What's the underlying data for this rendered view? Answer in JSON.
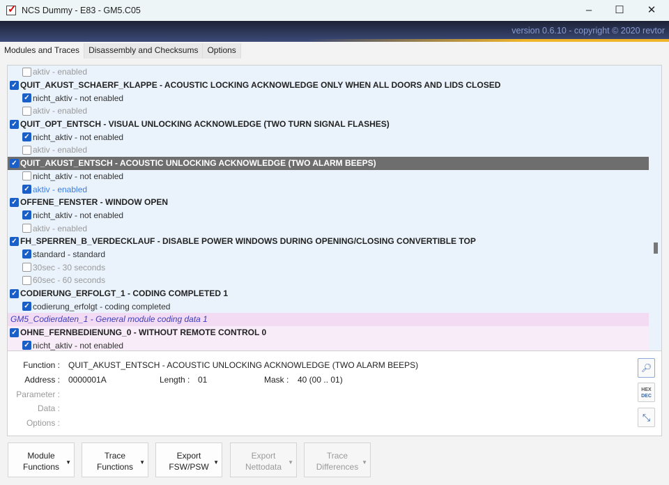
{
  "window": {
    "title": "NCS Dummy - E83 - GM5.C05",
    "minimize": "–",
    "maximize": "☐",
    "close": "✕"
  },
  "banner": {
    "version": "version 0.6.10 - copyright © 2020 revtor"
  },
  "tabs": [
    "Modules and Traces",
    "Disassembly and Checksums",
    "Options"
  ],
  "rows": [
    {
      "type": "opt",
      "state": "off",
      "checked": false,
      "text": "aktiv  -  enabled"
    },
    {
      "type": "head",
      "checked": true,
      "text": "QUIT_AKUST_SCHAERF_KLAPPE  -  ACOUSTIC LOCKING ACKNOWLEDGE ONLY WHEN ALL DOORS AND LIDS CLOSED"
    },
    {
      "type": "opt",
      "state": "on",
      "checked": true,
      "text": "nicht_aktiv  -  not enabled"
    },
    {
      "type": "opt",
      "state": "off",
      "checked": false,
      "text": "aktiv  -  enabled"
    },
    {
      "type": "head",
      "checked": true,
      "text": "QUIT_OPT_ENTSCH  -  VISUAL UNLOCKING ACKNOWLEDGE (TWO TURN SIGNAL FLASHES)"
    },
    {
      "type": "opt",
      "state": "on",
      "checked": true,
      "text": "nicht_aktiv  -  not enabled"
    },
    {
      "type": "opt",
      "state": "off",
      "checked": false,
      "text": "aktiv  -  enabled"
    },
    {
      "type": "head",
      "selected": true,
      "checked": true,
      "text": "QUIT_AKUST_ENTSCH  -  ACOUSTIC UNLOCKING ACKNOWLEDGE (TWO ALARM BEEPS)"
    },
    {
      "type": "opt",
      "state": "on",
      "checked": false,
      "text": "nicht_aktiv  -  not enabled"
    },
    {
      "type": "opt",
      "state": "blue",
      "checked": true,
      "text": "aktiv  -  enabled"
    },
    {
      "type": "head",
      "checked": true,
      "text": "OFFENE_FENSTER  -  WINDOW OPEN"
    },
    {
      "type": "opt",
      "state": "on",
      "checked": true,
      "text": "nicht_aktiv  -  not enabled"
    },
    {
      "type": "opt",
      "state": "off",
      "checked": false,
      "text": "aktiv  -  enabled"
    },
    {
      "type": "head",
      "checked": true,
      "text": "FH_SPERREN_B_VERDECKLAUF  -  DISABLE POWER WINDOWS DURING OPENING/CLOSING CONVERTIBLE TOP"
    },
    {
      "type": "opt",
      "state": "on",
      "checked": true,
      "text": "standard  -  standard"
    },
    {
      "type": "opt",
      "state": "off",
      "checked": false,
      "text": "30sec  -  30 seconds"
    },
    {
      "type": "opt",
      "state": "off",
      "checked": false,
      "text": "60sec  -  60 seconds"
    },
    {
      "type": "head",
      "checked": true,
      "text": "CODIERUNG_ERFOLGT_1  -  CODING COMPLETED 1"
    },
    {
      "type": "opt",
      "state": "on",
      "checked": true,
      "text": "codierung_erfolgt  -  coding completed"
    },
    {
      "type": "group",
      "text": "GM5_Codierdaten_1  -  General module coding data 1"
    },
    {
      "type": "head",
      "pink": true,
      "checked": true,
      "text": "OHNE_FERNBEDIENUNG_0  -  WITHOUT REMOTE CONTROL 0"
    },
    {
      "type": "opt",
      "pink": true,
      "state": "on",
      "checked": true,
      "text": "nicht_aktiv  -  not enabled"
    }
  ],
  "details": {
    "function_label": "Function :",
    "function_value": "QUIT_AKUST_ENTSCH  -  ACOUSTIC UNLOCKING ACKNOWLEDGE (TWO ALARM BEEPS)",
    "address_label": "Address :",
    "address_value": "0000001A",
    "length_label": "Length :",
    "length_value": "01",
    "mask_label": "Mask :",
    "mask_value": "40  (00 .. 01)",
    "parameter_label": "Parameter :",
    "data_label": "Data :",
    "options_label": "Options :",
    "hex_top": "HEX",
    "hex_bottom": "DEC"
  },
  "buttons": [
    {
      "l1": "Module",
      "l2": "Functions",
      "enabled": true
    },
    {
      "l1": "Trace",
      "l2": "Functions",
      "enabled": true
    },
    {
      "l1": "Export",
      "l2": "FSW/PSW",
      "enabled": true
    },
    {
      "l1": "Export",
      "l2": "Nettodata",
      "enabled": false
    },
    {
      "l1": "Trace",
      "l2": "Differences",
      "enabled": false
    }
  ]
}
